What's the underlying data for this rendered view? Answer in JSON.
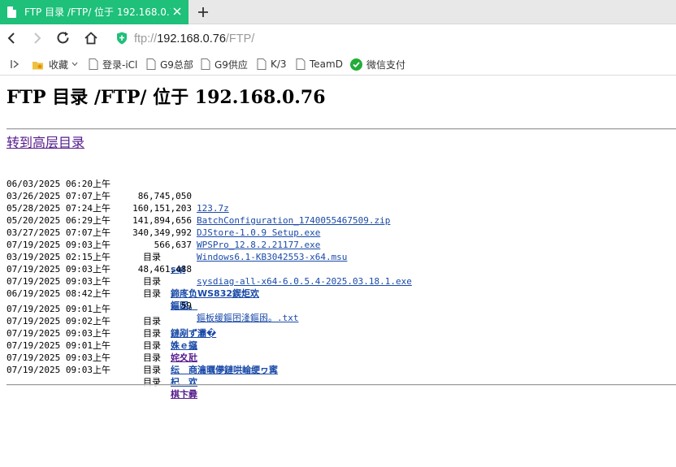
{
  "tab": {
    "title": "FTP 目录 /FTP/ 位于 192.168.0.76"
  },
  "toolbar": {
    "url_scheme": "ftp://",
    "url_host": "192.168.0.76",
    "url_path": "/FTP/"
  },
  "bookmarks": [
    {
      "label": "收藏",
      "icon": "star-folder-icon"
    },
    {
      "label": "登录-iCl",
      "icon": "page-icon"
    },
    {
      "label": "G9总部",
      "icon": "page-icon"
    },
    {
      "label": "G9供应",
      "icon": "page-icon"
    },
    {
      "label": "K/3",
      "icon": "page-icon"
    },
    {
      "label": "TeamD",
      "icon": "page-icon"
    },
    {
      "label": "微信支付",
      "icon": "wechat-pay-icon"
    }
  ],
  "page": {
    "title": "FTP 目录 /FTP/ 位于 192.168.0.76",
    "up_link": "转到高层目录"
  },
  "entries": [
    {
      "date": "06/03/2025 06:20上午",
      "size": "86,745,050",
      "name": "123.7z",
      "type": "file"
    },
    {
      "date": "03/26/2025 07:07上午",
      "size": "160,151,203",
      "name": "BatchConfiguration_1740055467509.zip",
      "type": "file"
    },
    {
      "date": "05/28/2025 07:24上午",
      "size": "141,894,656",
      "name": "DJStore-1.0.9 Setup.exe",
      "type": "file"
    },
    {
      "date": "05/20/2025 06:29上午",
      "size": "340,349,992",
      "name": "WPSPro_12.8.2.21177.exe",
      "type": "file"
    },
    {
      "date": "03/27/2025 07:07上午",
      "size": "566,637",
      "name": "Windows6.1-KB3042553-x64.msu",
      "type": "file"
    },
    {
      "date": "07/19/2025 09:03上午",
      "size": "目录",
      "name": "sql",
      "type": "dir"
    },
    {
      "date": "03/19/2025 02:15上午",
      "size": "48,461,488",
      "name": "sysdiag-all-x64-6.0.5.4-2025.03.18.1.exe",
      "type": "file"
    },
    {
      "date": "07/19/2025 09:03上午",
      "size": "目录",
      "name": "鍗庝负WS832鍥炬欢",
      "type": "dir"
    },
    {
      "date": "07/19/2025 09:03上午",
      "size": "目录",
      "name": "鏂囦。",
      "type": "dir"
    },
    {
      "date": "06/19/2025 08:42上午",
      "size": "59",
      "name": "鏂板缓鏂囨湰鏂囦。.txt",
      "type": "file"
    },
    {
      "date": "07/19/2025 09:01上午",
      "size": "目录",
      "name": "鏈剐ず灞�",
      "type": "dir"
    },
    {
      "date": "07/19/2025 09:02上午",
      "size": "目录",
      "name": "姝ｅ攨",
      "type": "dir"
    },
    {
      "date": "07/19/2025 09:03上午",
      "size": "目录",
      "name": "姹夊瓧",
      "type": "dir-visited"
    },
    {
      "date": "07/19/2025 09:01上午",
      "size": "目录",
      "name": "纭　商瀹曞儚鏈哄崘绠ヮ寗",
      "type": "dir"
    },
    {
      "date": "07/19/2025 09:03上午",
      "size": "目录",
      "name": "杞　欢",
      "type": "dir"
    },
    {
      "date": "07/19/2025 09:03上午",
      "size": "目录",
      "name": "棋卞彛",
      "type": "dir-visited"
    }
  ]
}
